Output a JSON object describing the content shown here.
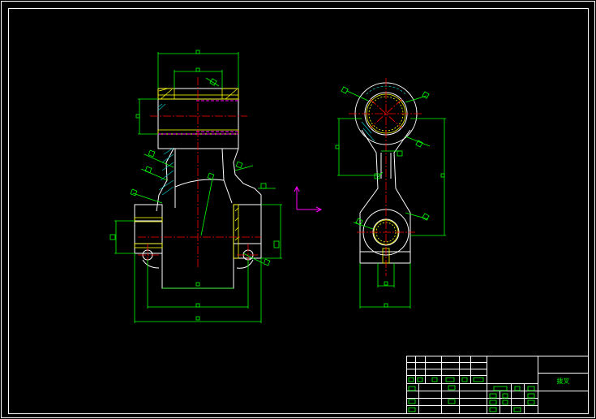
{
  "drawing": {
    "background": "#000000",
    "colors": {
      "outline": "#ffffff",
      "dimension": "#00ff00",
      "centerline": "#ff0000",
      "hatch": "#ffff00",
      "hidden": "#ff00ff",
      "section": "#00ffff",
      "ucs": "#ff00ff"
    },
    "views": [
      "front-section-view",
      "side-view"
    ],
    "ucs_icon": "ucs-axis-icon"
  },
  "title_block": {
    "drawing_name": "拨叉"
  }
}
